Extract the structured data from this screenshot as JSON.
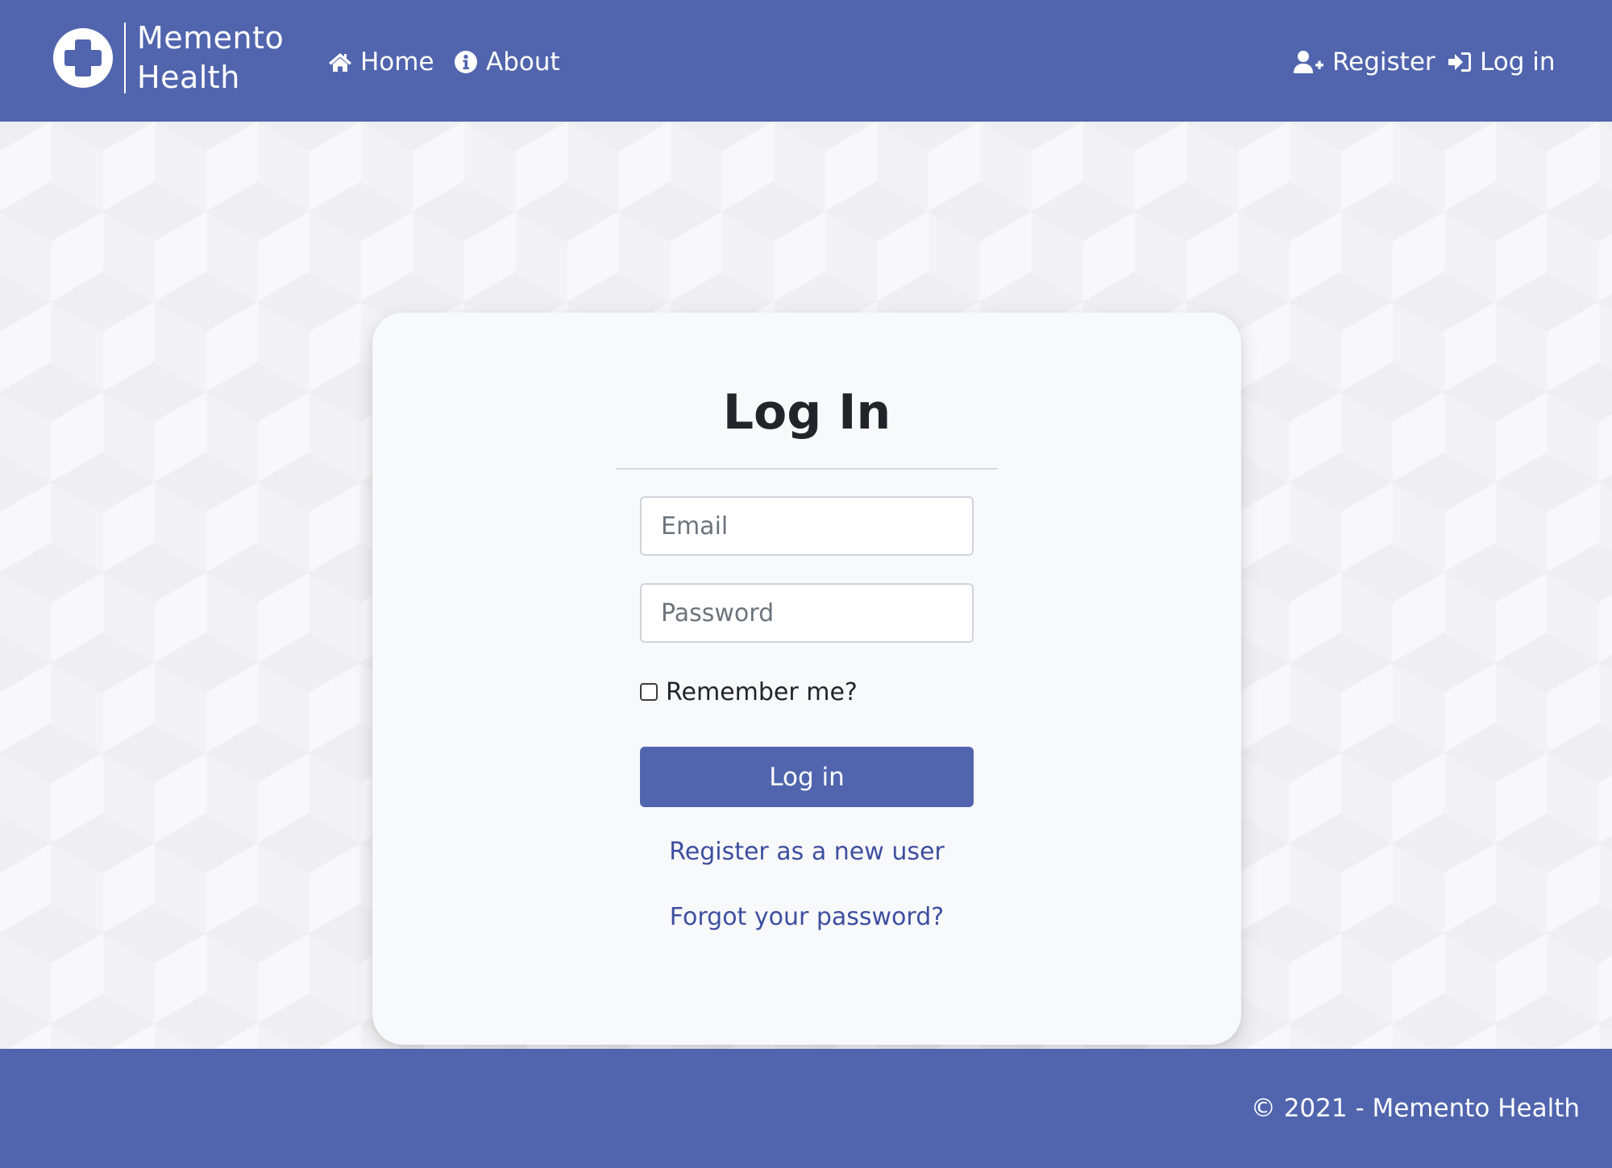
{
  "brand": {
    "name_line1": "Memento",
    "name_line2": "Health",
    "logo_icon": "medical-cross-icon"
  },
  "nav": {
    "home": {
      "label": "Home",
      "icon": "home-icon"
    },
    "about": {
      "label": "About",
      "icon": "info-circle-icon"
    },
    "register": {
      "label": "Register",
      "icon": "user-plus-icon"
    },
    "login": {
      "label": "Log in",
      "icon": "sign-in-icon"
    }
  },
  "login_form": {
    "title": "Log In",
    "email_placeholder": "Email",
    "email_value": "",
    "password_placeholder": "Password",
    "password_value": "",
    "remember_label": "Remember me?",
    "remember_checked": false,
    "submit_label": "Log in",
    "register_link": "Register as a new user",
    "forgot_link": "Forgot your password?"
  },
  "footer": {
    "text": "© 2021 - Memento Health"
  },
  "colors": {
    "brand": "#5165ae",
    "link": "#3e4fa0",
    "card_background": "#f8f9fb",
    "page_background": "#f8f8fa"
  }
}
